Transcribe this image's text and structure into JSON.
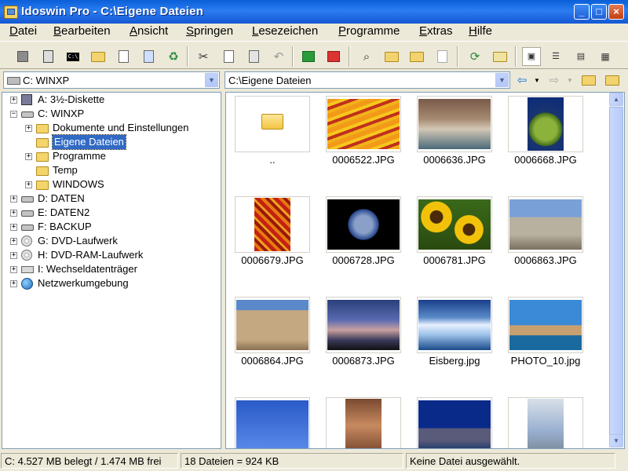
{
  "window": {
    "title": "Idoswin Pro - C:\\Eigene Dateien",
    "minimize": "_",
    "maximize": "□",
    "close": "×"
  },
  "menu": [
    {
      "label": "Datei",
      "ul": "D",
      "rest": "atei"
    },
    {
      "label": "Bearbeiten",
      "ul": "B",
      "rest": "earbeiten"
    },
    {
      "label": "Ansicht",
      "ul": "A",
      "rest": "nsicht"
    },
    {
      "label": "Springen",
      "ul": "S",
      "rest": "pringen"
    },
    {
      "label": "Lesezeichen",
      "ul": "L",
      "rest": "esezeichen"
    },
    {
      "label": "Programme",
      "ul": "P",
      "rest": "rogramme"
    },
    {
      "label": "Extras",
      "ul": "E",
      "rest": "xtras"
    },
    {
      "label": "Hilfe",
      "ul": "H",
      "rest": "ilfe"
    }
  ],
  "toolbar": {
    "cmd_glyph": "C:\\"
  },
  "drive_combo": {
    "value": "C: WINXP"
  },
  "path_combo": {
    "value": "C:\\Eigene Dateien"
  },
  "tree": [
    {
      "label": "A: 3½-Diskette",
      "icon": "floppy-icon",
      "expander": "+"
    },
    {
      "label": "C: WINXP",
      "icon": "drive-icon",
      "expander": "−"
    },
    {
      "label": "Dokumente und Einstellungen",
      "icon": "folder-icon",
      "expander": "+"
    },
    {
      "label": "Eigene Dateien",
      "icon": "folder-open-icon",
      "expander": ""
    },
    {
      "label": "Programme",
      "icon": "folder-icon",
      "expander": "+"
    },
    {
      "label": "Temp",
      "icon": "folder-icon",
      "expander": ""
    },
    {
      "label": "WINDOWS",
      "icon": "folder-icon",
      "expander": "+"
    },
    {
      "label": "D: DATEN",
      "icon": "drive-icon",
      "expander": "+"
    },
    {
      "label": "E: DATEN2",
      "icon": "drive-icon",
      "expander": "+"
    },
    {
      "label": "F: BACKUP",
      "icon": "drive-icon",
      "expander": "+"
    },
    {
      "label": "G: DVD-Laufwerk",
      "icon": "cd-icon",
      "expander": "+"
    },
    {
      "label": "H: DVD-RAM-Laufwerk",
      "icon": "cd-icon",
      "expander": "+"
    },
    {
      "label": "I: Wechseldatenträger",
      "icon": "removable-drive-icon",
      "expander": "+"
    },
    {
      "label": "Netzwerkumgebung",
      "icon": "network-icon",
      "expander": "+"
    }
  ],
  "selected_tree_item": "Eigene Dateien",
  "files": [
    {
      "name": "..",
      "kind": "parent-folder"
    },
    {
      "name": "0006522.JPG",
      "kind": "tulips"
    },
    {
      "name": "0006636.JPG",
      "kind": "venice-canal"
    },
    {
      "name": "0006668.JPG",
      "kind": "cactus"
    },
    {
      "name": "0006679.JPG",
      "kind": "autumn-leaves"
    },
    {
      "name": "0006728.JPG",
      "kind": "earth"
    },
    {
      "name": "0006781.JPG",
      "kind": "sunflowers"
    },
    {
      "name": "0006863.JPG",
      "kind": "ruins"
    },
    {
      "name": "0006864.JPG",
      "kind": "caryatids"
    },
    {
      "name": "0006873.JPG",
      "kind": "sunset-clouds"
    },
    {
      "name": "Eisberg.jpg",
      "kind": "iceberg"
    },
    {
      "name": "PHOTO_10.jpg",
      "kind": "venice-church"
    },
    {
      "name": "",
      "kind": "jet"
    },
    {
      "name": "",
      "kind": "petra"
    },
    {
      "name": "",
      "kind": "skyline"
    },
    {
      "name": "",
      "kind": "eiffel"
    }
  ],
  "status": {
    "disk": "C: 4.527 MB  belegt / 1.474 MB  frei",
    "count": "18 Dateien = 924 KB",
    "selection": "Keine Datei ausgewählt."
  }
}
